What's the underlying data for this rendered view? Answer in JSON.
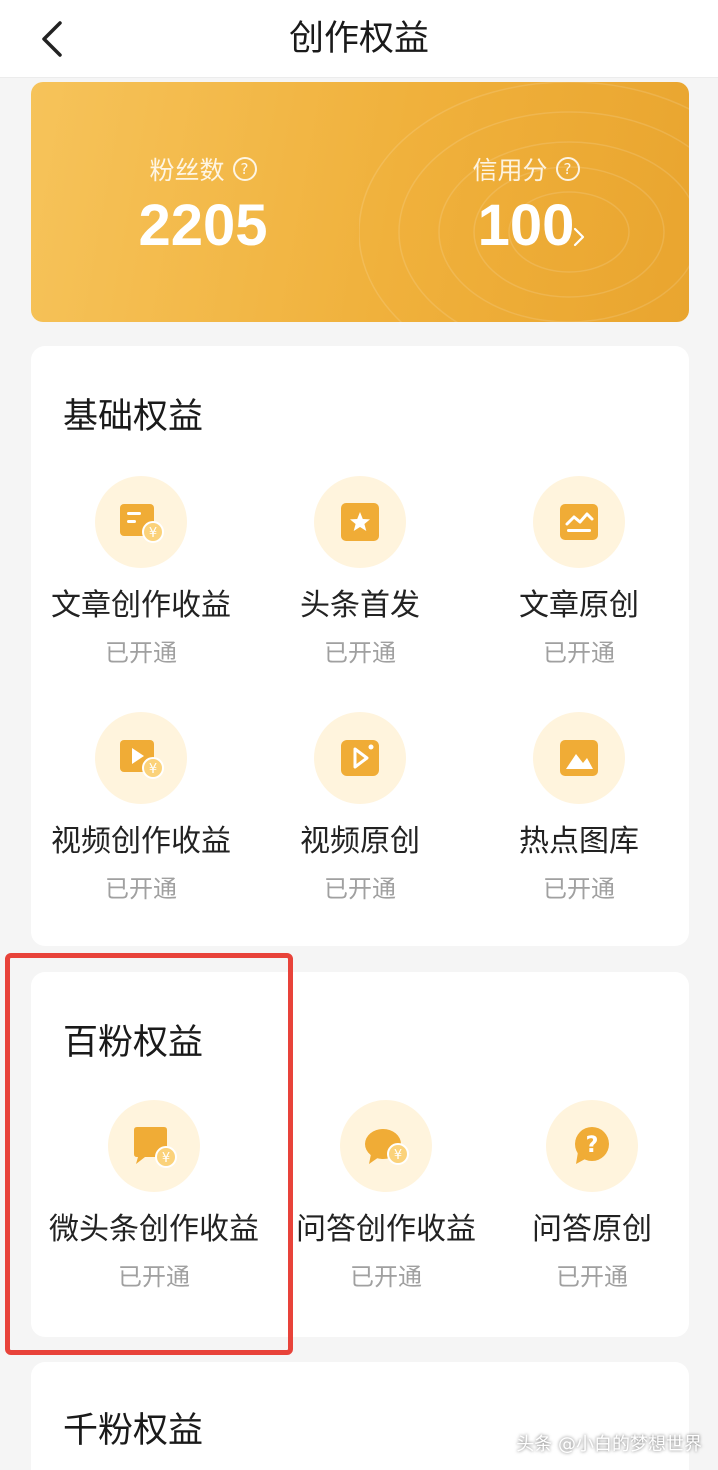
{
  "nav": {
    "title": "创作权益"
  },
  "stats": {
    "fans_label": "粉丝数",
    "fans_value": "2205",
    "credit_label": "信用分",
    "credit_value": "100",
    "help_icon": "?"
  },
  "basic": {
    "title": "基础权益",
    "items": [
      {
        "label": "文章创作收益",
        "status": "已开通",
        "icon": "article-income-icon"
      },
      {
        "label": "头条首发",
        "status": "已开通",
        "icon": "star-doc-icon"
      },
      {
        "label": "文章原创",
        "status": "已开通",
        "icon": "chart-doc-icon"
      },
      {
        "label": "视频创作收益",
        "status": "已开通",
        "icon": "video-income-icon"
      },
      {
        "label": "视频原创",
        "status": "已开通",
        "icon": "video-play-icon"
      },
      {
        "label": "热点图库",
        "status": "已开通",
        "icon": "image-gallery-icon"
      }
    ]
  },
  "hundred": {
    "title": "百粉权益",
    "items": [
      {
        "label": "微头条创作收益",
        "status": "已开通",
        "icon": "micro-post-income-icon"
      },
      {
        "label": "问答创作收益",
        "status": "已开通",
        "icon": "qa-income-icon"
      },
      {
        "label": "问答原创",
        "status": "已开通",
        "icon": "qa-question-icon"
      }
    ]
  },
  "thousand": {
    "title": "千粉权益"
  },
  "watermark": "头条 @小白的梦想世界",
  "colors": {
    "accent": "#f0b13c",
    "highlight": "#e8433a",
    "icon_bg": "#fff4dd"
  }
}
